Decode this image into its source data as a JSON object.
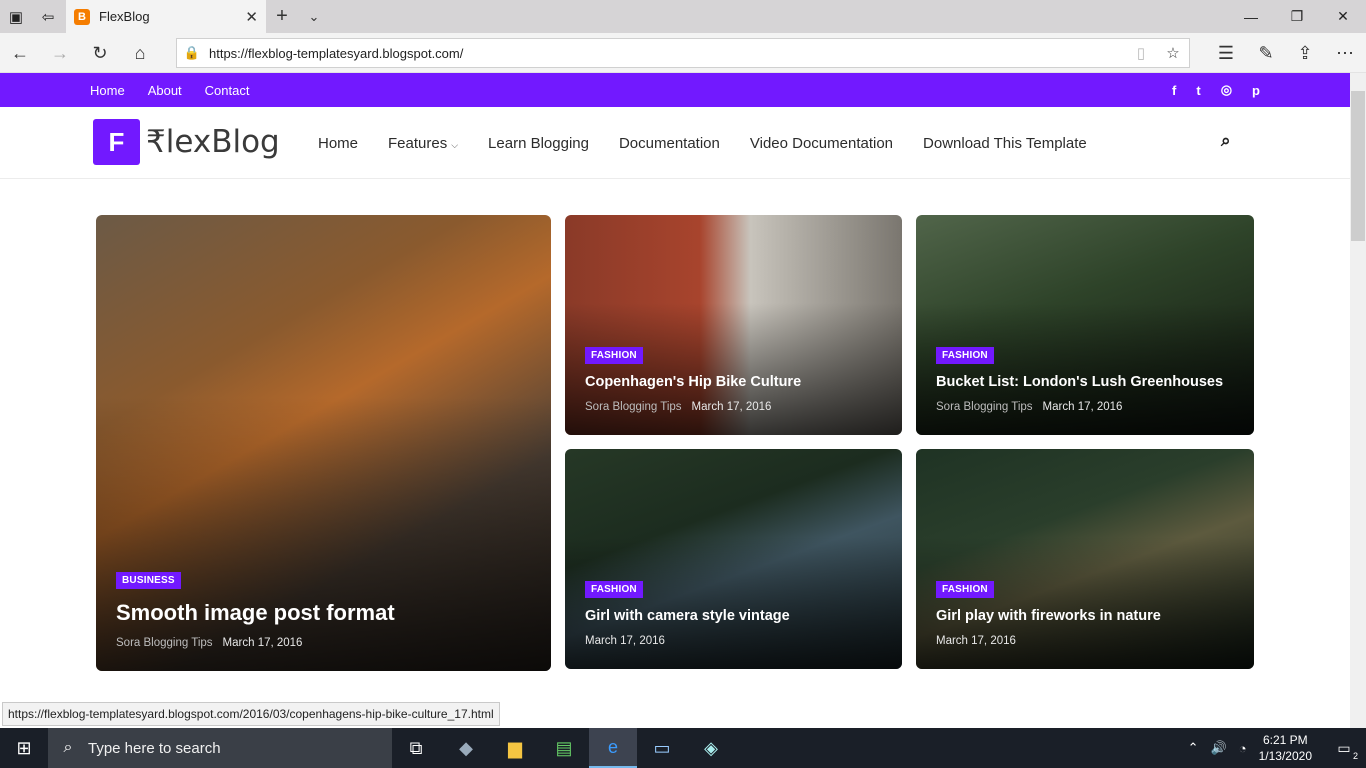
{
  "browser": {
    "tab_title": "FlexBlog",
    "favicon_letter": "B",
    "url": "https://flexblog-templatesyard.blogspot.com/",
    "status_url": "https://flexblog-templatesyard.blogspot.com/2016/03/copenhagens-hip-bike-culture_17.html"
  },
  "topbar": {
    "links": [
      "Home",
      "About",
      "Contact"
    ],
    "social_icons": [
      "facebook-icon",
      "twitter-icon",
      "instagram-icon",
      "pinterest-icon"
    ],
    "social_glyphs": [
      "f",
      "t",
      "◎",
      "p"
    ]
  },
  "header": {
    "logo_mark": "F",
    "logo_text": "₹lexBlog",
    "menu": [
      "Home",
      "Features",
      "Learn Blogging",
      "Documentation",
      "Video Documentation",
      "Download This Template"
    ]
  },
  "featured": [
    {
      "category": "BUSINESS",
      "title": "Smooth image post format",
      "author": "Sora Blogging Tips",
      "date": "March 17, 2016"
    },
    {
      "category": "FASHION",
      "title": "Copenhagen's Hip Bike Culture",
      "author": "Sora Blogging Tips",
      "date": "March 17, 2016"
    },
    {
      "category": "FASHION",
      "title": "Bucket List: London's Lush Greenhouses",
      "author": "Sora Blogging Tips",
      "date": "March 17, 2016"
    },
    {
      "category": "FASHION",
      "title": "Girl with camera style vintage",
      "author": "",
      "date": "March 17, 2016"
    },
    {
      "category": "FASHION",
      "title": "Girl play with fireworks in nature",
      "author": "",
      "date": "March 17, 2016"
    }
  ],
  "taskbar": {
    "search_placeholder": "Type here to search",
    "time": "6:21 PM",
    "date": "1/13/2020",
    "notifications": "2"
  },
  "colors": {
    "accent": "#7219ff",
    "taskbar": "#1a1f28"
  }
}
